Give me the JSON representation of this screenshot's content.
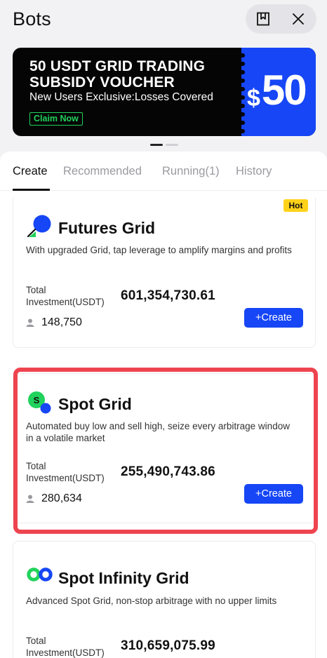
{
  "header": {
    "title": "Bots"
  },
  "banner": {
    "line1": "50 USDT GRID TRADING",
    "line2": "SUBSIDY VOUCHER",
    "subtitle": "New Users Exclusive:Losses Covered",
    "cta": "Claim Now",
    "currency_symbol": "$",
    "amount": "50",
    "colors": {
      "background": "#050505",
      "voucher": "#1646f5",
      "cta": "#21d25c"
    }
  },
  "tabs": [
    {
      "label": "Create",
      "active": true
    },
    {
      "label": "Recommended",
      "active": false
    },
    {
      "label": "Running(1)",
      "active": false
    },
    {
      "label": "History",
      "active": false
    }
  ],
  "cards": [
    {
      "name": "Futures Grid",
      "badge": "Hot",
      "description": "With upgraded Grid, tap leverage to amplify margins and profits",
      "investment_label": "Total Investment(USDT)",
      "investment": "601,354,730.61",
      "users": "148,750",
      "button": "+Create",
      "icon": "futures-grid-icon"
    },
    {
      "name": "Spot Grid",
      "description": "Automated buy low and sell high, seize every arbitrage window in a volatile market",
      "investment_label": "Total Investment(USDT)",
      "investment": "255,490,743.86",
      "users": "280,634",
      "button": "+Create",
      "icon": "spot-grid-icon",
      "highlighted": true
    },
    {
      "name": "Spot Infinity Grid",
      "description": "Advanced Spot Grid, non-stop arbitrage with no upper limits",
      "investment_label": "Total Investment(USDT)",
      "investment": "310,659,075.99",
      "icon": "spot-infinity-grid-icon"
    }
  ],
  "colors": {
    "accent": "#1646f5",
    "highlight": "#ee4450",
    "hot_badge": "#ffd21a",
    "green": "#21d25c"
  }
}
